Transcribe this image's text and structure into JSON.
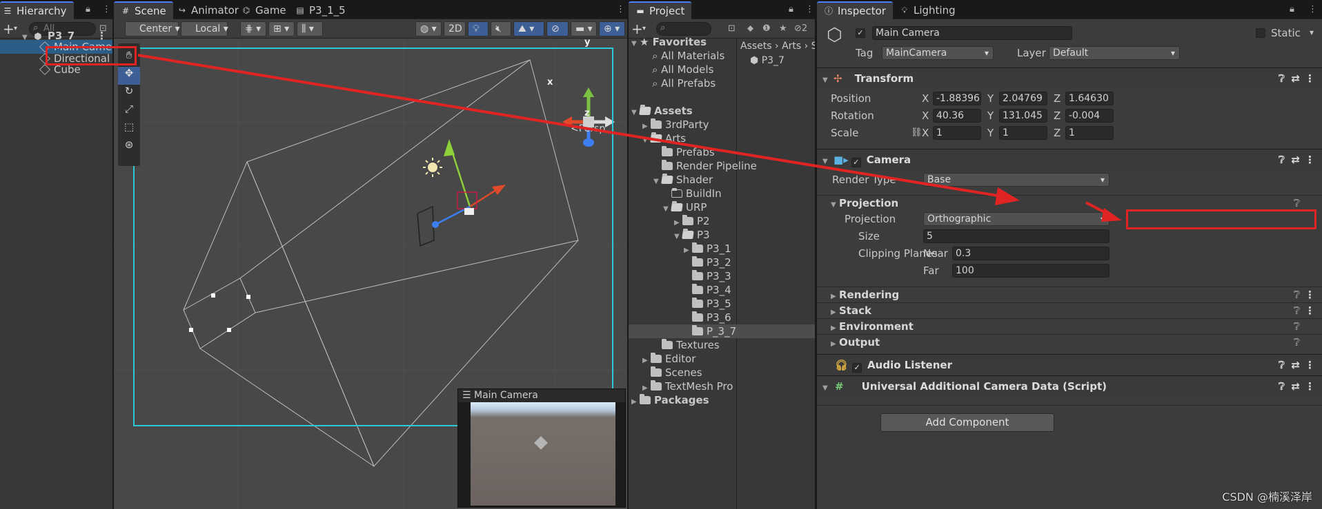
{
  "hierarchy": {
    "tab": "Hierarchy",
    "search": "All",
    "scene": "P3_7",
    "items": [
      "Main Camera",
      "Directional Lig",
      "Cube"
    ]
  },
  "scene_view": {
    "tabs": [
      "Scene",
      "Animator",
      "Game",
      "P3_1_5"
    ],
    "pivot": "Center",
    "space": "Local",
    "mode2d": "2D",
    "persp_label": "<Persp",
    "axis_x": "x",
    "axis_y": "y",
    "axis_z": "z",
    "preview_title": "Main Camera",
    "grid_color": "#48484a",
    "outline_color": "#2ec9d6"
  },
  "project": {
    "tab": "Project",
    "favorites_label": "Favorites",
    "favorites": [
      "All Materials",
      "All Models",
      "All Prefabs"
    ],
    "assets_label": "Assets",
    "tree": [
      "3rdParty",
      "Arts",
      "Prefabs",
      "Render Pipeline",
      "Shader",
      "BuildIn",
      "URP",
      "P2",
      "P3",
      "P3_1",
      "P3_2",
      "P3_3",
      "P3_4",
      "P3_5",
      "P3_6",
      "P_3_7",
      "Textures",
      "Editor",
      "Scenes",
      "TextMesh Pro"
    ],
    "packages_label": "Packages",
    "breadcrumb": [
      "Assets",
      "Arts",
      "S"
    ],
    "asset_item": "P3_7",
    "hidden_count": "2"
  },
  "inspector": {
    "tabs": [
      "Inspector",
      "Lighting"
    ],
    "object_name": "Main Camera",
    "static_label": "Static",
    "tag_label": "Tag",
    "tag_value": "MainCamera",
    "layer_label": "Layer",
    "layer_value": "Default",
    "transform": {
      "title": "Transform",
      "position_label": "Position",
      "rotation_label": "Rotation",
      "scale_label": "Scale",
      "position": [
        "-1.88396",
        "2.04769",
        "1.64630"
      ],
      "rotation": [
        "40.36",
        "131.045",
        "-0.004"
      ],
      "scale": [
        "1",
        "1",
        "1"
      ],
      "x": "X",
      "y": "Y",
      "z": "Z"
    },
    "camera": {
      "title": "Camera",
      "render_type_label": "Render Type",
      "render_type": "Base",
      "projection_header": "Projection",
      "projection_label": "Projection",
      "projection_value": "Orthographic",
      "size_label": "Size",
      "size_value": "5",
      "clipping_label": "Clipping Planes",
      "near_label": "Near",
      "near_value": "0.3",
      "far_label": "Far",
      "far_value": "100",
      "sections": [
        "Rendering",
        "Stack",
        "Environment",
        "Output"
      ]
    },
    "audio": {
      "title": "Audio Listener"
    },
    "urp": {
      "title": "Universal Additional Camera Data (Script)"
    },
    "add_component": "Add Component"
  },
  "watermark": "CSDN @楠溪泽岸",
  "colors": {
    "selection": "#2c5d87",
    "highlight": "#e02424",
    "accent": "#4c7fff"
  }
}
